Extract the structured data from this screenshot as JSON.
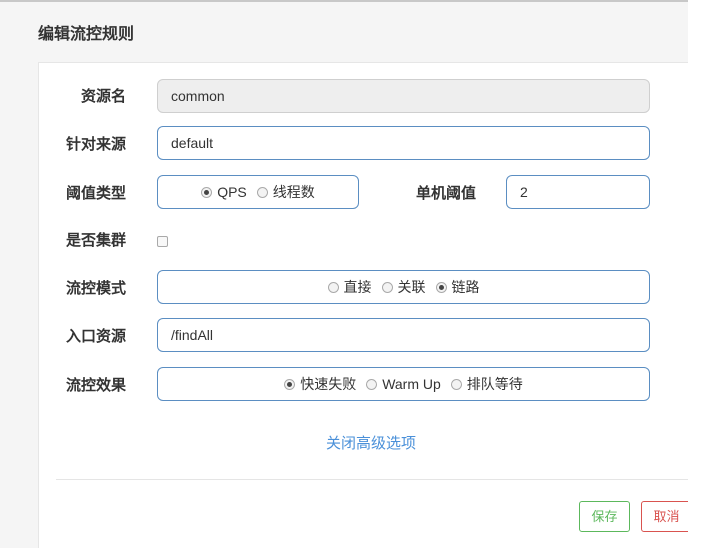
{
  "dialog": {
    "title": "编辑流控规则"
  },
  "form": {
    "resource": {
      "label": "资源名",
      "value": "common"
    },
    "limitApp": {
      "label": "针对来源",
      "value": "default"
    },
    "grade": {
      "label": "阈值类型",
      "options": [
        "QPS",
        "线程数"
      ],
      "selected": "QPS"
    },
    "count": {
      "label": "单机阈值",
      "value": "2"
    },
    "cluster": {
      "label": "是否集群",
      "checked": false
    },
    "strategy": {
      "label": "流控模式",
      "options": [
        "直接",
        "关联",
        "链路"
      ],
      "selected": "链路"
    },
    "refResource": {
      "label": "入口资源",
      "value": "/findAll"
    },
    "controlBehavior": {
      "label": "流控效果",
      "options": [
        "快速失败",
        "Warm Up",
        "排队等待"
      ],
      "selected": "快速失败"
    }
  },
  "advanced_toggle": "关闭高级选项",
  "footer": {
    "save_label": "保存",
    "cancel_label": "取消"
  },
  "colors": {
    "field_border": "#5b8ec2",
    "link": "#4a90d9",
    "save": "#5cb85c",
    "cancel": "#d9534f"
  }
}
